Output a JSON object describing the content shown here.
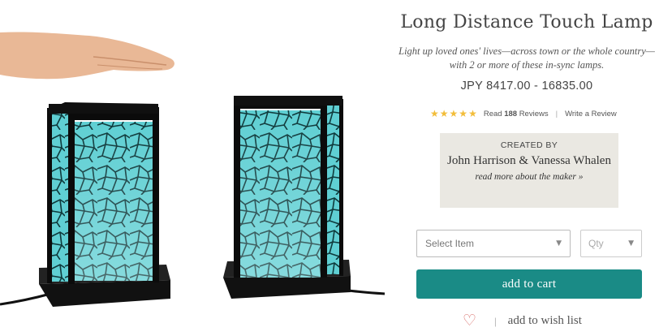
{
  "product": {
    "title": "Long Distance Touch Lamp",
    "subtitle_line1": "Light up loved ones' lives—across town or the whole country—",
    "subtitle_line2": "with 2 or more of these in-sync lamps.",
    "price": "JPY 8417.00 - 16835.00",
    "image_icon": "touch-lamp-pair-photo"
  },
  "reviews": {
    "rating": 5,
    "rating_max": 5,
    "read_prefix": "Read",
    "count": "188",
    "read_suffix": "Reviews",
    "separator": "|",
    "write_label": "Write a Review",
    "star_color": "#f2bd3a"
  },
  "maker": {
    "heading": "CREATED BY",
    "names": "John Harrison & Vanessa Whalen",
    "link_label": "read more about the maker",
    "link_arrow": "»"
  },
  "purchase": {
    "item_placeholder": "Select Item",
    "qty_placeholder": "Qty",
    "add_to_cart_label": "add to cart",
    "cart_color": "#1a8b86",
    "separator": "|",
    "wishlist_label": "add to wish list",
    "heart_icon": "heart-icon"
  }
}
